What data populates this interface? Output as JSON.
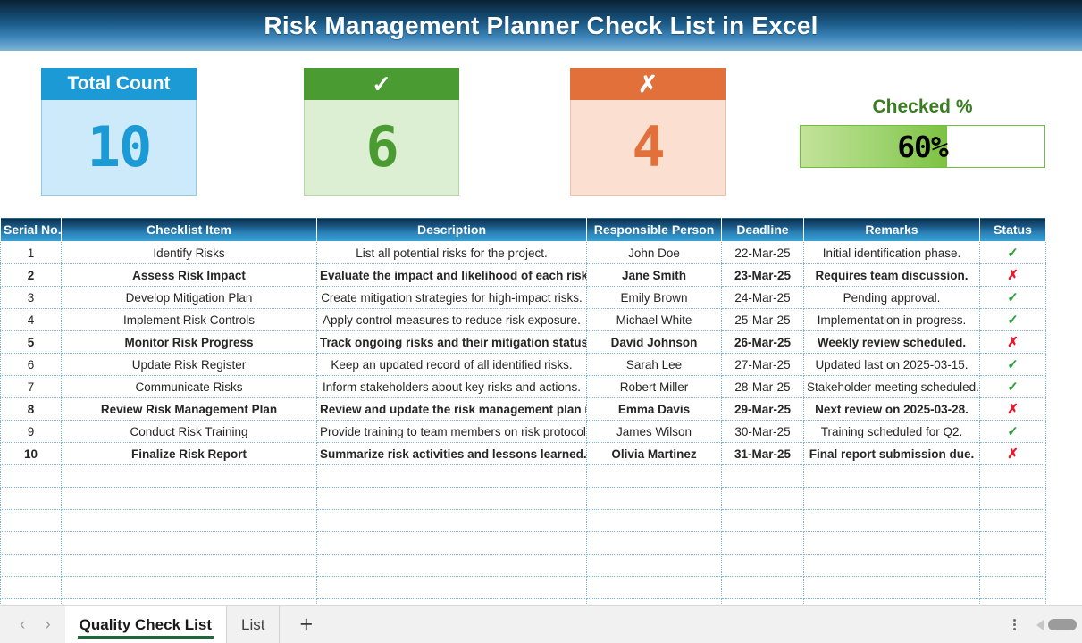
{
  "banner": {
    "title": "Risk Management Planner Check List in Excel"
  },
  "kpis": [
    {
      "name": "total-count",
      "label": "Total Count",
      "value": "10",
      "accent": "#1c9ad6",
      "body": "#cdeafb"
    },
    {
      "name": "checked-count",
      "label": "✓",
      "value": "6",
      "accent": "#4a9b31",
      "body": "#ddefd2"
    },
    {
      "name": "unchecked-count",
      "label": "✗",
      "value": "4",
      "accent": "#e2703a",
      "body": "#fbdfd0"
    }
  ],
  "gauge": {
    "label": "Checked %",
    "value_text": "60%",
    "percent": 60,
    "fill_color": "#7cc242",
    "border_color": "#6fbf3f",
    "label_color": "#3a7d22"
  },
  "table": {
    "headers": [
      "Serial No.",
      "Checklist Item",
      "Description",
      "Responsible Person",
      "Deadline",
      "Remarks",
      "Status"
    ],
    "status_checked": "✓",
    "status_unchecked": "✗",
    "blank_row_count": 7,
    "rows": [
      {
        "serial": "1",
        "item": "Identify Risks",
        "desc": "List all potential risks for the project.",
        "person": "John Doe",
        "deadline": "22-Mar-25",
        "remarks": "Initial identification phase.",
        "status": "✓",
        "checked": true
      },
      {
        "serial": "2",
        "item": "Assess Risk Impact",
        "desc": "Evaluate the impact and likelihood of each risk.",
        "person": "Jane Smith",
        "deadline": "23-Mar-25",
        "remarks": "Requires team discussion.",
        "status": "✗",
        "checked": false
      },
      {
        "serial": "3",
        "item": "Develop Mitigation Plan",
        "desc": "Create mitigation strategies for high-impact risks.",
        "person": "Emily Brown",
        "deadline": "24-Mar-25",
        "remarks": "Pending approval.",
        "status": "✓",
        "checked": true
      },
      {
        "serial": "4",
        "item": "Implement Risk Controls",
        "desc": "Apply control measures to reduce risk exposure.",
        "person": "Michael White",
        "deadline": "25-Mar-25",
        "remarks": "Implementation in progress.",
        "status": "✓",
        "checked": true
      },
      {
        "serial": "5",
        "item": "Monitor Risk Progress",
        "desc": "Track ongoing risks and their mitigation status.",
        "person": "David Johnson",
        "deadline": "26-Mar-25",
        "remarks": "Weekly review scheduled.",
        "status": "✗",
        "checked": false
      },
      {
        "serial": "6",
        "item": "Update Risk Register",
        "desc": "Keep an updated record of all identified risks.",
        "person": "Sarah Lee",
        "deadline": "27-Mar-25",
        "remarks": "Updated last on 2025-03-15.",
        "status": "✓",
        "checked": true
      },
      {
        "serial": "7",
        "item": "Communicate Risks",
        "desc": "Inform stakeholders about key risks and actions.",
        "person": "Robert Miller",
        "deadline": "28-Mar-25",
        "remarks": "Stakeholder meeting scheduled.",
        "status": "✓",
        "checked": true
      },
      {
        "serial": "8",
        "item": "Review Risk Management Plan",
        "desc": "Review and update the risk management plan regularly.",
        "person": "Emma Davis",
        "deadline": "29-Mar-25",
        "remarks": "Next review on 2025-03-28.",
        "status": "✗",
        "checked": false
      },
      {
        "serial": "9",
        "item": "Conduct Risk Training",
        "desc": "Provide training to team members on risk protocols.",
        "person": "James Wilson",
        "deadline": "30-Mar-25",
        "remarks": "Training scheduled for Q2.",
        "status": "✓",
        "checked": true
      },
      {
        "serial": "10",
        "item": "Finalize Risk Report",
        "desc": "Summarize risk activities and lessons learned.",
        "person": "Olivia Martinez",
        "deadline": "31-Mar-25",
        "remarks": "Final report submission due.",
        "status": "✗",
        "checked": false
      }
    ]
  },
  "sheetbar": {
    "prev_icon": "‹",
    "next_icon": "›",
    "add_icon": "+",
    "tabs": [
      {
        "label": "Quality Check List",
        "active": true
      },
      {
        "label": "List",
        "active": false
      }
    ]
  }
}
